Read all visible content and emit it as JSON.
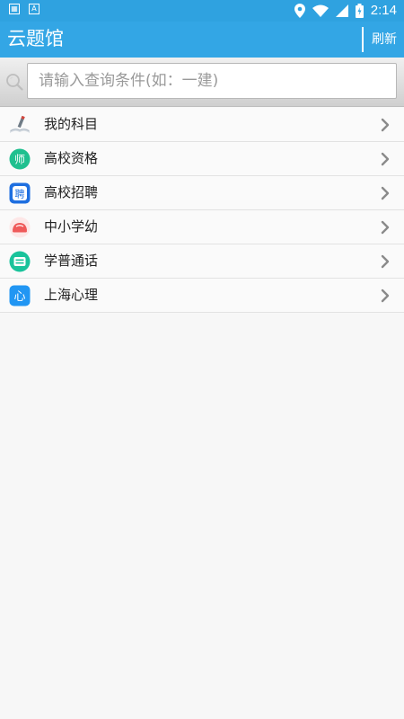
{
  "status_bar": {
    "time": "2:14",
    "left_icons": [
      "notification-icon",
      "a-icon"
    ],
    "right_icons": [
      "location-icon",
      "wifi-icon",
      "signal-icon",
      "battery-icon"
    ]
  },
  "app_bar": {
    "title": "云题馆",
    "refresh_label": "刷新",
    "color": "#33a6e5"
  },
  "search": {
    "placeholder": "请输入查询条件(如：一建)",
    "value": ""
  },
  "subjects": [
    {
      "label": "我的科目",
      "icon": "pencil-book-icon"
    },
    {
      "label": "高校资格",
      "icon": "teacher-icon"
    },
    {
      "label": "高校招聘",
      "icon": "recruit-icon"
    },
    {
      "label": "中小学幼",
      "icon": "school-icon"
    },
    {
      "label": "学普通话",
      "icon": "mandarin-icon"
    },
    {
      "label": "上海心理",
      "icon": "psychology-icon"
    }
  ]
}
